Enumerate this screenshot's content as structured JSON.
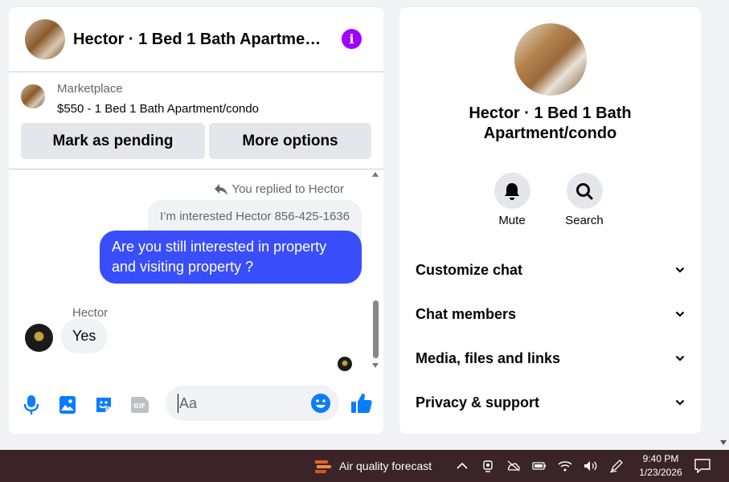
{
  "chat": {
    "title": "Hector · 1 Bed 1 Bath Apartment/condo",
    "market": {
      "source": "Marketplace",
      "listing": "$550 - 1 Bed 1 Bath Apartment/condo",
      "pending_label": "Mark as pending",
      "more_label": "More options"
    },
    "messages": {
      "replied_label": "You replied to Hector",
      "quoted_text": "I’m interested Hector 856-425-1636",
      "outgoing_text": "Are you still interested in property and visiting property ?",
      "sender_name": "Hector",
      "incoming_text": "Yes"
    },
    "composer": {
      "placeholder": "Aa"
    },
    "colors": {
      "accent": "#0a7cff",
      "outgoing_bubble": "#3a4dfb",
      "info_icon": "#a100ff"
    }
  },
  "info": {
    "title": "Hector · 1 Bed 1 Bath Apartment/condo",
    "actions": [
      {
        "label": "Mute",
        "icon": "bell-icon"
      },
      {
        "label": "Search",
        "icon": "search-icon"
      }
    ],
    "sections": [
      {
        "label": "Customize chat"
      },
      {
        "label": "Chat members"
      },
      {
        "label": "Media, files and links"
      },
      {
        "label": "Privacy & support"
      }
    ]
  },
  "taskbar": {
    "weather_label": "Air quality forecast",
    "time": "9:40 PM",
    "date": "1/23/2026"
  }
}
